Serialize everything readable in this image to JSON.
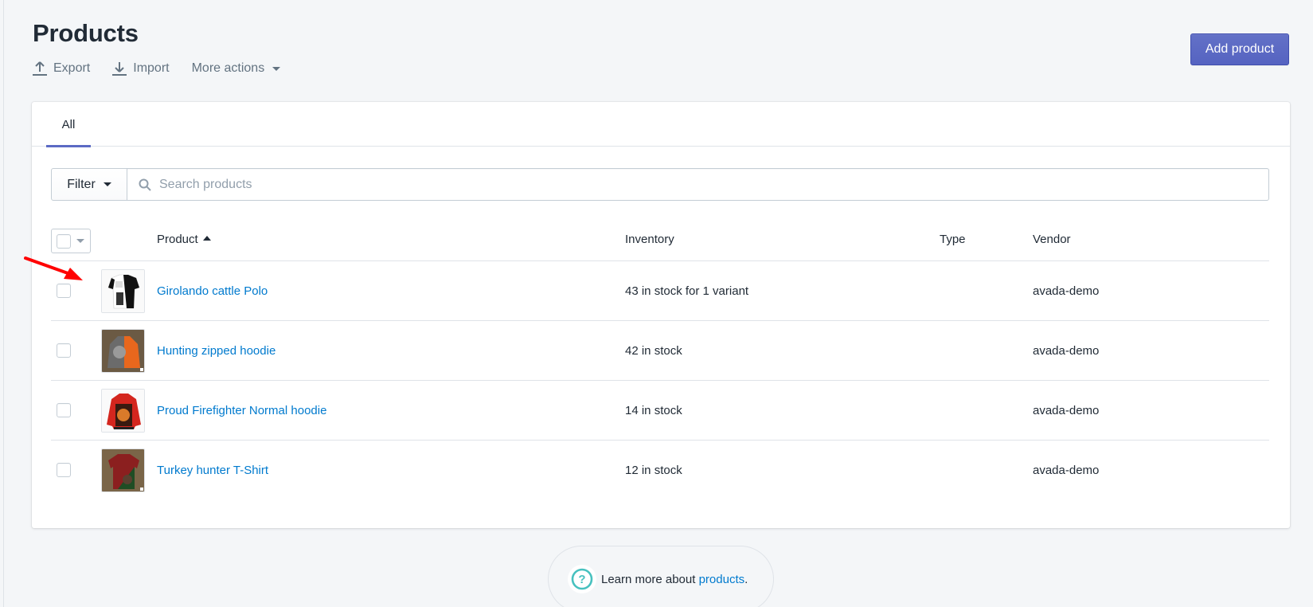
{
  "header": {
    "title": "Products",
    "actions": [
      {
        "label": "Export",
        "icon": "export-icon"
      },
      {
        "label": "Import",
        "icon": "import-icon"
      },
      {
        "label": "More actions",
        "icon": "caret-down-icon"
      }
    ],
    "primary_button": "Add product"
  },
  "tabs": [
    {
      "label": "All",
      "active": true
    }
  ],
  "filter": {
    "filter_label": "Filter",
    "search_placeholder": "Search products",
    "search_value": ""
  },
  "table": {
    "columns": [
      "Product",
      "Inventory",
      "Type",
      "Vendor"
    ],
    "sort": {
      "column": "Product",
      "direction": "ascending"
    },
    "rows": [
      {
        "product": "Girolando cattle Polo",
        "inventory": "43 in stock for 1 variant",
        "type": "",
        "vendor": "avada-demo",
        "thumb": "black-white polo shirt"
      },
      {
        "product": "Hunting zipped hoodie",
        "inventory": "42 in stock",
        "type": "",
        "vendor": "avada-demo",
        "thumb": "orange-grey hoodie"
      },
      {
        "product": "Proud Firefighter Normal hoodie",
        "inventory": "14 in stock",
        "type": "",
        "vendor": "avada-demo",
        "thumb": "red bomber hoodie"
      },
      {
        "product": "Turkey hunter T-Shirt",
        "inventory": "12 in stock",
        "type": "",
        "vendor": "avada-demo",
        "thumb": "red-green t-shirt"
      }
    ]
  },
  "help": {
    "prefix": "Learn more about ",
    "link": "products",
    "suffix": "."
  },
  "colors": {
    "accent": "#5c6ac4",
    "link": "#007ace",
    "help_icon": "#47c1bf",
    "annotation_arrow": "#ff0000"
  }
}
